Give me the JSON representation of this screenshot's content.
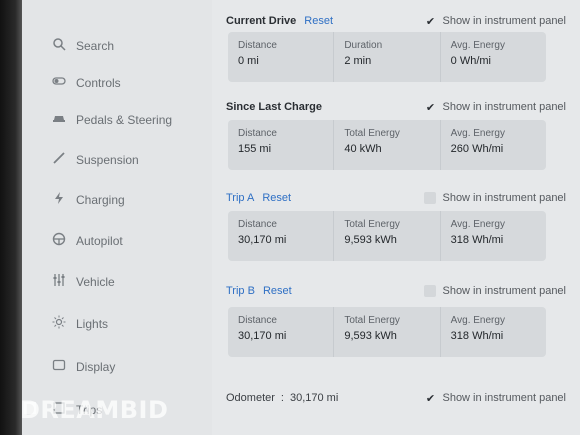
{
  "sidebar": {
    "items": [
      {
        "label": "Search",
        "icon": "search-icon"
      },
      {
        "label": "Controls",
        "icon": "toggle-icon"
      },
      {
        "label": "Pedals & Steering",
        "icon": "car-icon"
      },
      {
        "label": "Suspension",
        "icon": "suspension-icon"
      },
      {
        "label": "Charging",
        "icon": "lightning-icon"
      },
      {
        "label": "Autopilot",
        "icon": "steering-wheel-icon"
      },
      {
        "label": "Vehicle",
        "icon": "sliders-icon"
      },
      {
        "label": "Lights",
        "icon": "sun-icon"
      },
      {
        "label": "Display",
        "icon": "display-icon"
      },
      {
        "label": "Trips",
        "icon": "trips-icon"
      }
    ]
  },
  "trips": {
    "current_drive": {
      "title": "Current Drive",
      "reset": "Reset",
      "show_label": "Show in instrument panel",
      "show_checked": true,
      "fields": [
        {
          "label": "Distance",
          "value": "0 mi"
        },
        {
          "label": "Duration",
          "value": "2 min"
        },
        {
          "label": "Avg. Energy",
          "value": "0 Wh/mi"
        }
      ]
    },
    "since_last_charge": {
      "title": "Since Last Charge",
      "show_label": "Show in instrument panel",
      "show_checked": true,
      "fields": [
        {
          "label": "Distance",
          "value": "155 mi"
        },
        {
          "label": "Total Energy",
          "value": "40 kWh"
        },
        {
          "label": "Avg. Energy",
          "value": "260 Wh/mi"
        }
      ]
    },
    "trip_a": {
      "title": "Trip A",
      "reset": "Reset",
      "show_label": "Show in instrument panel",
      "show_checked": false,
      "fields": [
        {
          "label": "Distance",
          "value": "30,170 mi"
        },
        {
          "label": "Total Energy",
          "value": "9,593 kWh"
        },
        {
          "label": "Avg. Energy",
          "value": "318 Wh/mi"
        }
      ]
    },
    "trip_b": {
      "title": "Trip B",
      "reset": "Reset",
      "show_label": "Show in instrument panel",
      "show_checked": false,
      "fields": [
        {
          "label": "Distance",
          "value": "30,170 mi"
        },
        {
          "label": "Total Energy",
          "value": "9,593 kWh"
        },
        {
          "label": "Avg. Energy",
          "value": "318 Wh/mi"
        }
      ]
    },
    "odometer": {
      "label": "Odometer",
      "separator": ":",
      "value": "30,170 mi",
      "show_label": "Show in instrument panel",
      "show_checked": true
    }
  },
  "watermark": "DREAMBID",
  "colors": {
    "accent": "#2e6fc4",
    "card": "#d6d9dc",
    "background": "#e6e8ea"
  }
}
